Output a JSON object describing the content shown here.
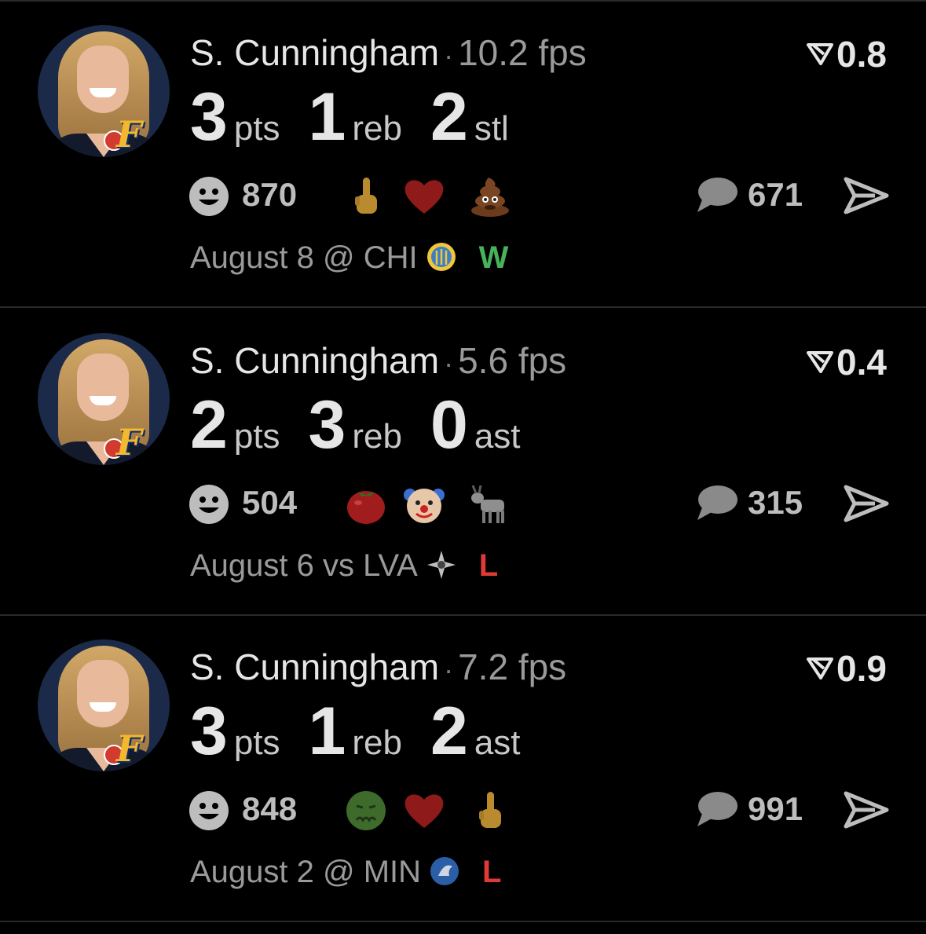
{
  "cards": [
    {
      "player": "S. Cunningham",
      "fps": "10.2 fps",
      "rating": "0.8",
      "stats": [
        {
          "value": "3",
          "unit": "pts"
        },
        {
          "value": "1",
          "unit": "reb"
        },
        {
          "value": "2",
          "unit": "stl"
        }
      ],
      "reactions_count": "870",
      "reaction_emojis": [
        "middle-finger",
        "heart",
        "poop"
      ],
      "comments_count": "671",
      "game": "August 8 @ CHI",
      "opponent_logo": "chicago-sky-logo",
      "result": "W"
    },
    {
      "player": "S. Cunningham",
      "fps": "5.6 fps",
      "rating": "0.4",
      "stats": [
        {
          "value": "2",
          "unit": "pts"
        },
        {
          "value": "3",
          "unit": "reb"
        },
        {
          "value": "0",
          "unit": "ast"
        }
      ],
      "reactions_count": "504",
      "reaction_emojis": [
        "tomato",
        "clown",
        "goat"
      ],
      "comments_count": "315",
      "game": "August 6 vs LVA",
      "opponent_logo": "las-vegas-aces-logo",
      "result": "L"
    },
    {
      "player": "S. Cunningham",
      "fps": "7.2 fps",
      "rating": "0.9",
      "stats": [
        {
          "value": "3",
          "unit": "pts"
        },
        {
          "value": "1",
          "unit": "reb"
        },
        {
          "value": "2",
          "unit": "ast"
        }
      ],
      "reactions_count": "848",
      "reaction_emojis": [
        "nauseated-face",
        "heart",
        "middle-finger"
      ],
      "comments_count": "991",
      "game": "August 2 @ MIN",
      "opponent_logo": "minnesota-lynx-logo",
      "result": "L"
    }
  ],
  "colors": {
    "win": "#47b25a",
    "loss": "#e03a36",
    "background": "#000000"
  }
}
